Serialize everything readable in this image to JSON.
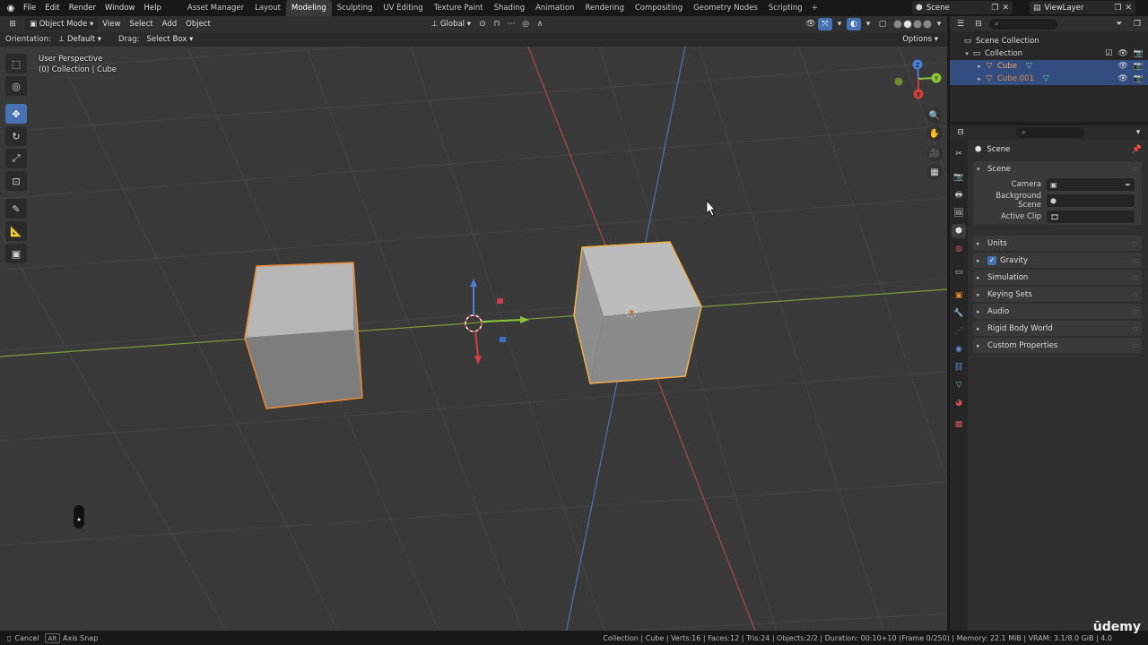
{
  "topbar": {
    "menus": [
      "File",
      "Edit",
      "Render",
      "Window",
      "Help"
    ],
    "workspaces": [
      "Asset Manager",
      "Layout",
      "Modeling",
      "Sculpting",
      "UV Editing",
      "Texture Paint",
      "Shading",
      "Animation",
      "Rendering",
      "Compositing",
      "Geometry Nodes",
      "Scripting"
    ],
    "active_workspace": "Modeling",
    "add_tab": "+",
    "scene_name": "Scene",
    "view_layer": "ViewLayer"
  },
  "viewport_header": {
    "mode": "Object Mode",
    "menus": [
      "View",
      "Select",
      "Add",
      "Object"
    ],
    "transform_orientation": "Global"
  },
  "tool_settings": {
    "orientation_label": "Orientation:",
    "orientation_value": "Default",
    "drag_label": "Drag:",
    "drag_value": "Select Box",
    "options_label": "Options"
  },
  "viewport": {
    "perspective_label": "User Perspective",
    "collection_label": "(0) Collection | Cube",
    "gizmo_axes": {
      "z": "Z",
      "y": "Y",
      "x": "X"
    }
  },
  "outliner": {
    "search_placeholder": "",
    "scene_collection": "Scene Collection",
    "collection": "Collection",
    "objects": [
      {
        "name": "Cube",
        "selected": true
      },
      {
        "name": "Cube.001",
        "selected": true
      }
    ]
  },
  "properties": {
    "title": "Scene",
    "scene_panel": "Scene",
    "camera_label": "Camera",
    "background_scene_label": "Background Scene",
    "active_clip_label": "Active Clip",
    "panels": [
      "Units",
      "Gravity",
      "Simulation",
      "Keying Sets",
      "Audio",
      "Rigid Body World",
      "Custom Properties"
    ],
    "gravity_checked": true
  },
  "statusbar": {
    "cancel_label": "Cancel",
    "alt_key": "Alt",
    "axis_snap_label": "Axis Snap",
    "stats": "Collection | Cube | Verts:16 | Faces:12 | Tris:24 | Objects:2/2 | Duration: 00:10+10 (Frame 0/250) | Memory: 22.1 MiB | VRAM: 3.1/8.0 GiB | 4.0",
    "watermark": "ūdemy"
  },
  "colors": {
    "selection_outline": "#e8892f",
    "active_outline": "#f0b04a",
    "x_axis": "#c0443c",
    "y_axis": "#8fb03a",
    "z_axis": "#4477cc",
    "accent": "#4772b3"
  }
}
